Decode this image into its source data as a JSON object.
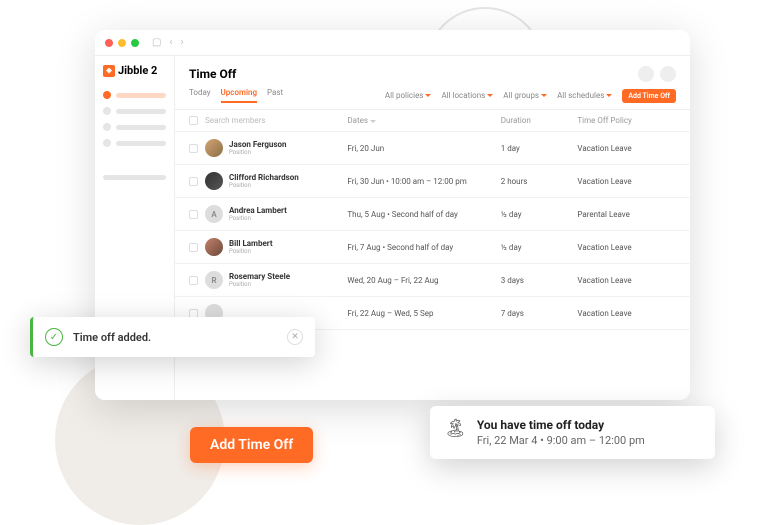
{
  "brand": "Jibble 2",
  "page_title": "Time Off",
  "tabs": {
    "today": "Today",
    "upcoming": "Upcoming",
    "past": "Past"
  },
  "filters": {
    "policies": "All policies",
    "locations": "All locations",
    "groups": "All groups",
    "schedules": "All schedules"
  },
  "add_button": "Add Time Off",
  "table_headers": {
    "search": "Search members",
    "dates": "Dates",
    "duration": "Duration",
    "policy": "Time Off Policy"
  },
  "rows": [
    {
      "name": "Jason Ferguson",
      "role": "Position",
      "dates": "Fri, 20 Jun",
      "duration": "1 day",
      "policy": "Vacation Leave",
      "avatar_type": "img1"
    },
    {
      "name": "Clifford Richardson",
      "role": "Position",
      "dates": "Fri, 30 Jun • 10:00 am – 12:00 pm",
      "duration": "2 hours",
      "policy": "Vacation Leave",
      "avatar_type": "img2"
    },
    {
      "name": "Andrea Lambert",
      "role": "Position",
      "dates": "Thu, 5 Aug • Second half of day",
      "duration": "½ day",
      "policy": "Parental Leave",
      "avatar_type": "letter",
      "letter": "A"
    },
    {
      "name": "Bill Lambert",
      "role": "Position",
      "dates": "Fri, 7 Aug • Second half of day",
      "duration": "½ day",
      "policy": "Vacation Leave",
      "avatar_type": "img3"
    },
    {
      "name": "Rosemary Steele",
      "role": "Position",
      "dates": "Wed, 20 Aug – Fri, 22 Aug",
      "duration": "3 days",
      "policy": "Vacation Leave",
      "avatar_type": "letter",
      "letter": "R"
    },
    {
      "name": "",
      "role": "",
      "dates": "Fri, 22 Aug – Wed, 5 Sep",
      "duration": "7 days",
      "policy": "Vacation Leave",
      "avatar_type": "blank"
    }
  ],
  "toast": {
    "message": "Time off added."
  },
  "cta": "Add Time Off",
  "notification": {
    "title": "You have time off today",
    "subtitle": "Fri, 22 Mar 4 • 9:00 am – 12:00 pm"
  }
}
